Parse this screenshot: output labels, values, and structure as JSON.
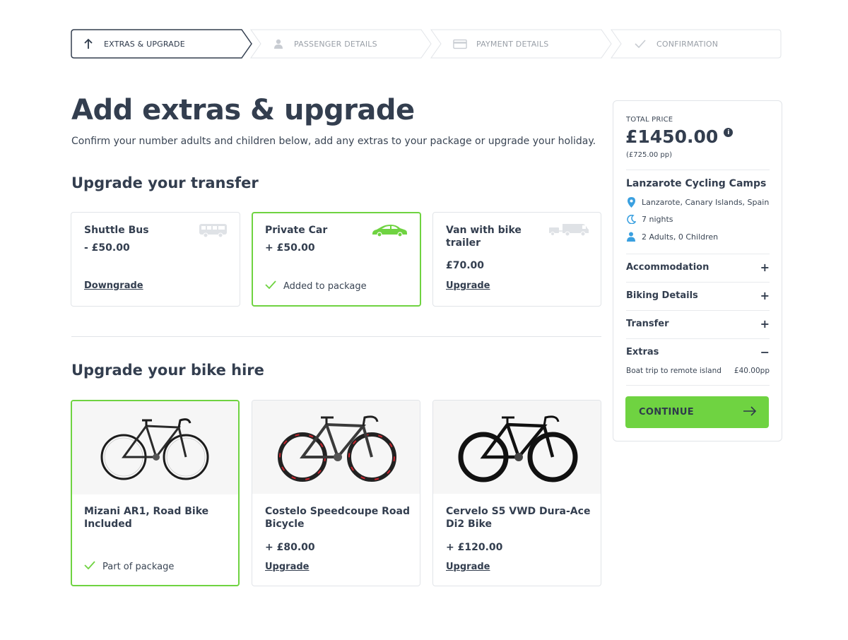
{
  "stepper": {
    "steps": [
      {
        "label": "EXTRAS & UPGRADE",
        "icon": "arrow-up-icon",
        "state": "active"
      },
      {
        "label": "PASSENGER DETAILS",
        "icon": "person-icon",
        "state": "inactive"
      },
      {
        "label": "PAYMENT DETAILS",
        "icon": "credit-card-icon",
        "state": "inactive"
      },
      {
        "label": "CONFIRMATION",
        "icon": "check-icon",
        "state": "inactive"
      }
    ]
  },
  "main": {
    "title": "Add extras & upgrade",
    "subtitle": "Confirm your number adults and children below, add any extras to your package or upgrade your holiday."
  },
  "transfer": {
    "heading": "Upgrade your transfer",
    "options": [
      {
        "name": "Shuttle Bus",
        "price": "- £50.00",
        "action": "Downgrade",
        "icon": "bus-icon",
        "selected": false
      },
      {
        "name": "Private Car",
        "price": "+ £50.00",
        "status": "Added to package",
        "icon": "car-icon",
        "selected": true
      },
      {
        "name": "Van with bike trailer",
        "price": "£70.00",
        "action": "Upgrade",
        "icon": "van-trailer-icon",
        "selected": false
      }
    ]
  },
  "bike": {
    "heading": "Upgrade your bike hire",
    "options": [
      {
        "name": "Mizani AR1, Road Bike Included",
        "status": "Part of package",
        "selected": true
      },
      {
        "name": "Costelo Speedcoupe Road Bicycle",
        "price": "+ £80.00",
        "action": "Upgrade",
        "selected": false
      },
      {
        "name": "Cervelo S5 VWD Dura-Ace Di2 Bike",
        "price": "+ £120.00",
        "action": "Upgrade",
        "selected": false
      }
    ]
  },
  "summary": {
    "total_label": "TOTAL PRICE",
    "total_value": "£1450.00",
    "info_glyph": "i",
    "per_person": "(£725.00 pp)",
    "trip_title": "Lanzarote Cycling Camps",
    "location": "Lanzarote, Canary Islands, Spain",
    "nights": "7 nights",
    "travellers": "2 Adults, 0 Children",
    "sections": [
      {
        "label": "Accommodation",
        "sign": "+"
      },
      {
        "label": "Biking Details",
        "sign": "+"
      },
      {
        "label": "Transfer",
        "sign": "+"
      },
      {
        "label": "Extras",
        "sign": "−"
      }
    ],
    "extras": [
      {
        "label": "Boat trip to remote island",
        "price": "£40.00pp"
      }
    ],
    "continue_label": "CONTINUE"
  },
  "colors": {
    "accent_green": "#6fd341",
    "text_dark": "#333e4f",
    "icon_blue": "#3aa0e0"
  }
}
